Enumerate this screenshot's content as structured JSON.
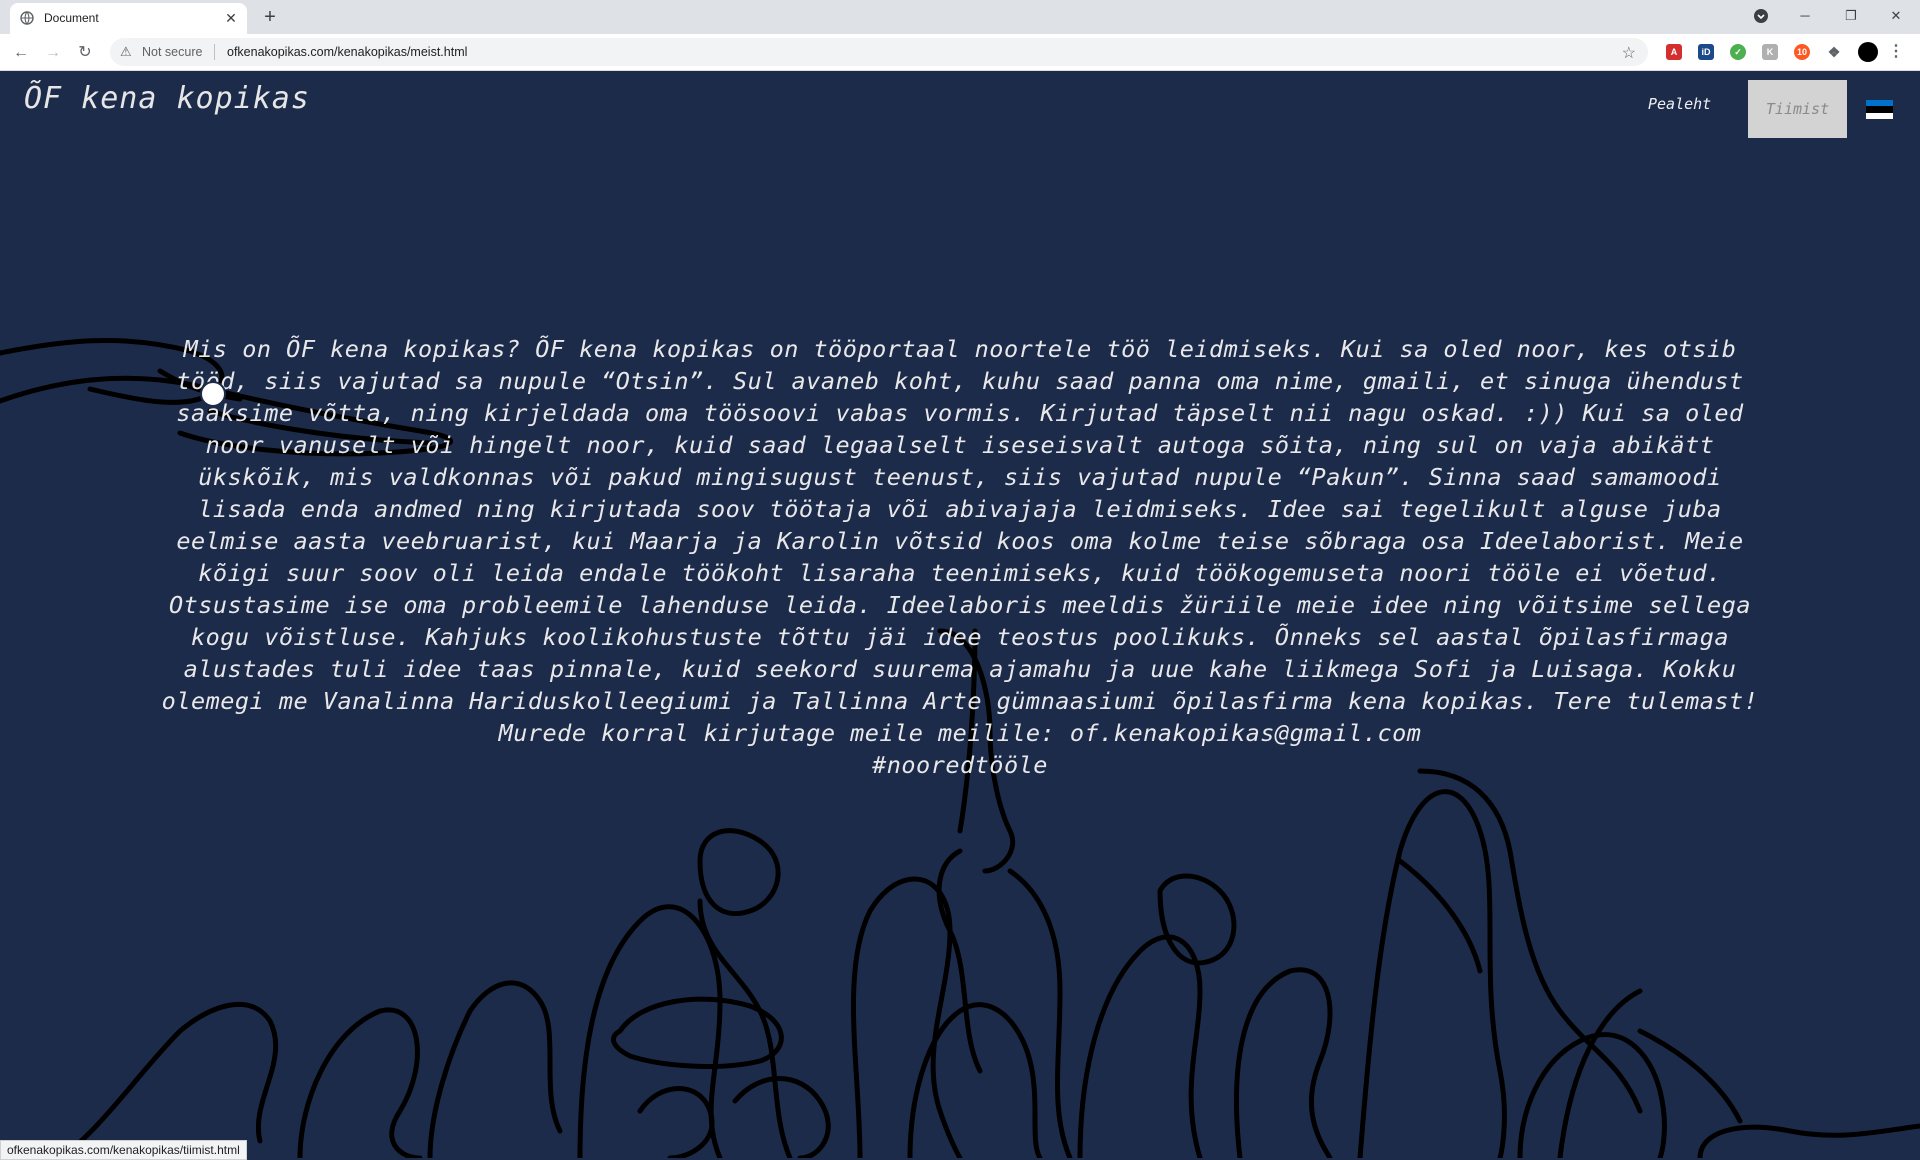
{
  "browser": {
    "tab_title": "Document",
    "tab_close": "✕",
    "new_tab": "+",
    "security_label": "Not secure",
    "url": "ofkenakopikas.com/kenakopikas/meist.html",
    "status_url": "ofkenakopikas.com/kenakopikas/tiimist.html",
    "window_controls": {
      "minimize": "─",
      "maximize": "❐",
      "close": "✕"
    },
    "extensions": [
      "acrobat-icon",
      "id-icon",
      "shield-icon",
      "ext-icon",
      "counter-icon",
      "puzzle-icon",
      "profile-avatar"
    ]
  },
  "site": {
    "logo": "ÕF kena kopikas",
    "nav": {
      "home": "Pealeht",
      "team": "Tiimist"
    },
    "flag_colors": [
      "#0072ce",
      "#000000",
      "#ffffff"
    ],
    "background_color": "#1d2b4b",
    "intro_text": "Mis on ÕF kena kopikas? ÕF kena kopikas on tööportaal noortele töö leidmiseks. Kui sa oled noor, kes otsib tööd, siis vajutad sa nupule “Otsin”. Sul avaneb koht, kuhu saad panna oma nime, gmaili, et sinuga ühendust saaksime võtta, ning kirjeldada oma töösoovi vabas vormis. Kirjutad täpselt nii nagu oskad. :)) Kui sa oled noor vanuselt või hingelt noor, kuid saad legaalselt iseseisvalt autoga sõita, ning sul on vaja abikätt ükskõik, mis valdkonnas või pakud mingisugust teenust, siis vajutad nupule “Pakun”. Sinna saad samamoodi lisada enda andmed ning kirjutada soov töötaja või abivajaja leidmiseks. Idee sai tegelikult alguse juba eelmise aasta veebruarist, kui Maarja ja Karolin võtsid koos oma kolme teise sõbraga osa Ideelaborist. Meie kõigi suur soov oli leida endale töökoht lisaraha teenimiseks, kuid töökogemuseta noori tööle ei võetud. Otsustasime ise oma probleemile lahenduse leida. Ideelaboris meeldis žüriile meie idee ning võitsime sellega kogu võistluse. Kahjuks koolikohustuste tõttu jäi idee teostus poolikuks. Õnneks sel aastal õpilasfirmaga alustades tuli idee taas pinnale, kuid seekord suurema ajamahu ja uue kahe liikmega Sofi ja Luisaga. Kokku olemegi me Vanalinna Hariduskolleegiumi ja Tallinna Arte gümnaasiumi õpilasfirma kena kopikas. Tere tulemast! Murede korral kirjutage meile meilile: of.kenakopikas@gmail.com",
    "hashtag": "#nooredtööle"
  }
}
